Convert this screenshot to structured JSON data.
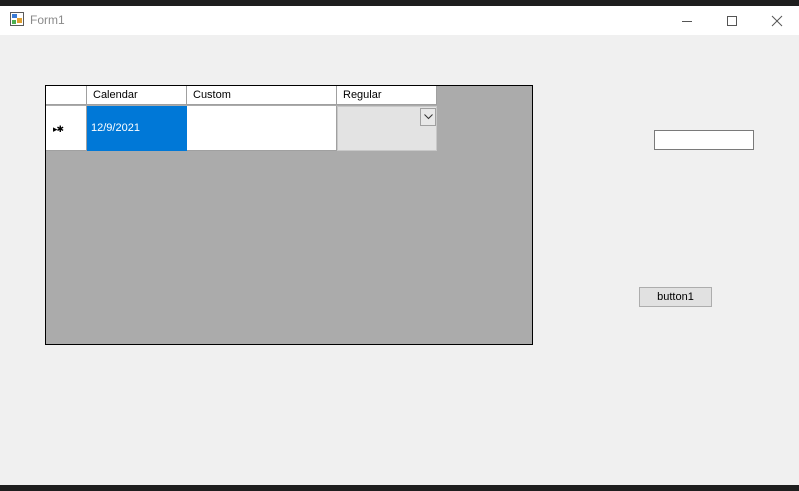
{
  "window": {
    "title": "Form1"
  },
  "grid": {
    "columns": [
      "Calendar",
      "Custom",
      "Regular"
    ],
    "rows": [
      {
        "indicator": "▸✱",
        "calendar": "12/9/2021",
        "custom": "",
        "regular": ""
      }
    ]
  },
  "textbox1": {
    "value": ""
  },
  "button1": {
    "label": "button1"
  },
  "colors": {
    "selection": "#0078d7",
    "grid_background": "#ababab",
    "form_background": "#f0f0f0"
  }
}
